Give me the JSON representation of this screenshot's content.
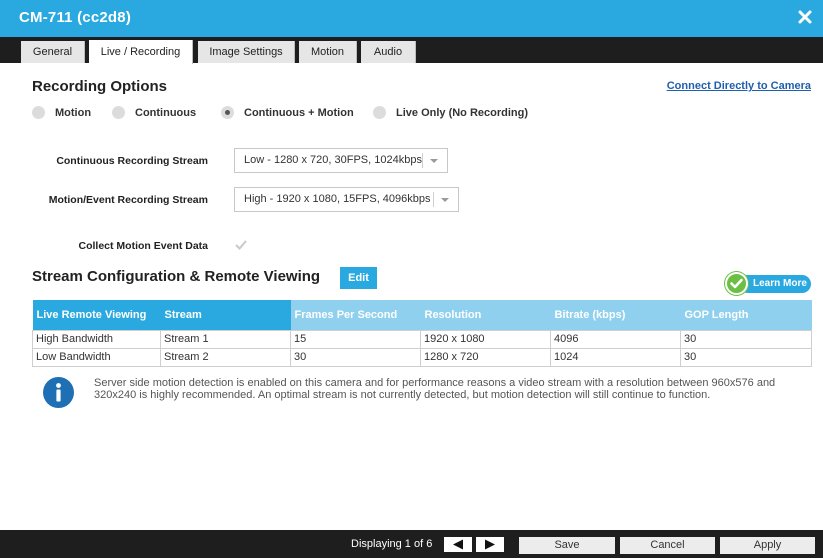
{
  "window": {
    "title": "CM-711 (cc2d8)",
    "close_icon": "close-icon"
  },
  "tabs": [
    {
      "label": "General",
      "active": false
    },
    {
      "label": "Live / Recording",
      "active": true
    },
    {
      "label": "Image Settings",
      "active": false
    },
    {
      "label": "Motion",
      "active": false
    },
    {
      "label": "Audio",
      "active": false
    }
  ],
  "recording": {
    "title": "Recording Options",
    "connect_link": "Connect Directly to Camera",
    "options": [
      {
        "label": "Motion",
        "checked": false
      },
      {
        "label": "Continuous",
        "checked": false
      },
      {
        "label": "Continuous + Motion",
        "checked": true
      },
      {
        "label": "Live Only (No Recording)",
        "checked": false
      }
    ],
    "continuous_stream_label": "Continuous Recording Stream",
    "continuous_stream_value": "Low - 1280 x 720, 30FPS, 1024kbps",
    "motion_stream_label": "Motion/Event Recording Stream",
    "motion_stream_value": "High - 1920 x 1080, 15FPS, 4096kbps",
    "collect_label": "Collect Motion Event Data",
    "collect_checked": true
  },
  "stream_config": {
    "title": "Stream Configuration & Remote Viewing",
    "edit_label": "Edit",
    "learn_more_label": "Learn More",
    "headers": [
      "Live Remote Viewing",
      "Stream",
      "Frames Per Second",
      "Resolution",
      "Bitrate (kbps)",
      "GOP Length"
    ],
    "rows": [
      [
        "High Bandwidth",
        "Stream 1",
        "15",
        "1920 x 1080",
        "4096",
        "30"
      ],
      [
        "Low Bandwidth",
        "Stream 2",
        "30",
        "1280 x 720",
        "1024",
        "30"
      ]
    ]
  },
  "info": {
    "text": "Server side motion detection is enabled on this camera and for performance reasons a video stream with a resolution between 960x576 and 320x240 is highly recommended. An optimal stream is not currently detected, but motion detection will still continue to function."
  },
  "footer": {
    "displaying": "Displaying 1 of 6",
    "save": "Save",
    "cancel": "Cancel",
    "apply": "Apply"
  },
  "colors": {
    "accent": "#2aa9e0",
    "accent_light": "#8fd0ee",
    "dark": "#1e1e1e",
    "success": "#6cbf43",
    "link": "#1f5fad"
  }
}
